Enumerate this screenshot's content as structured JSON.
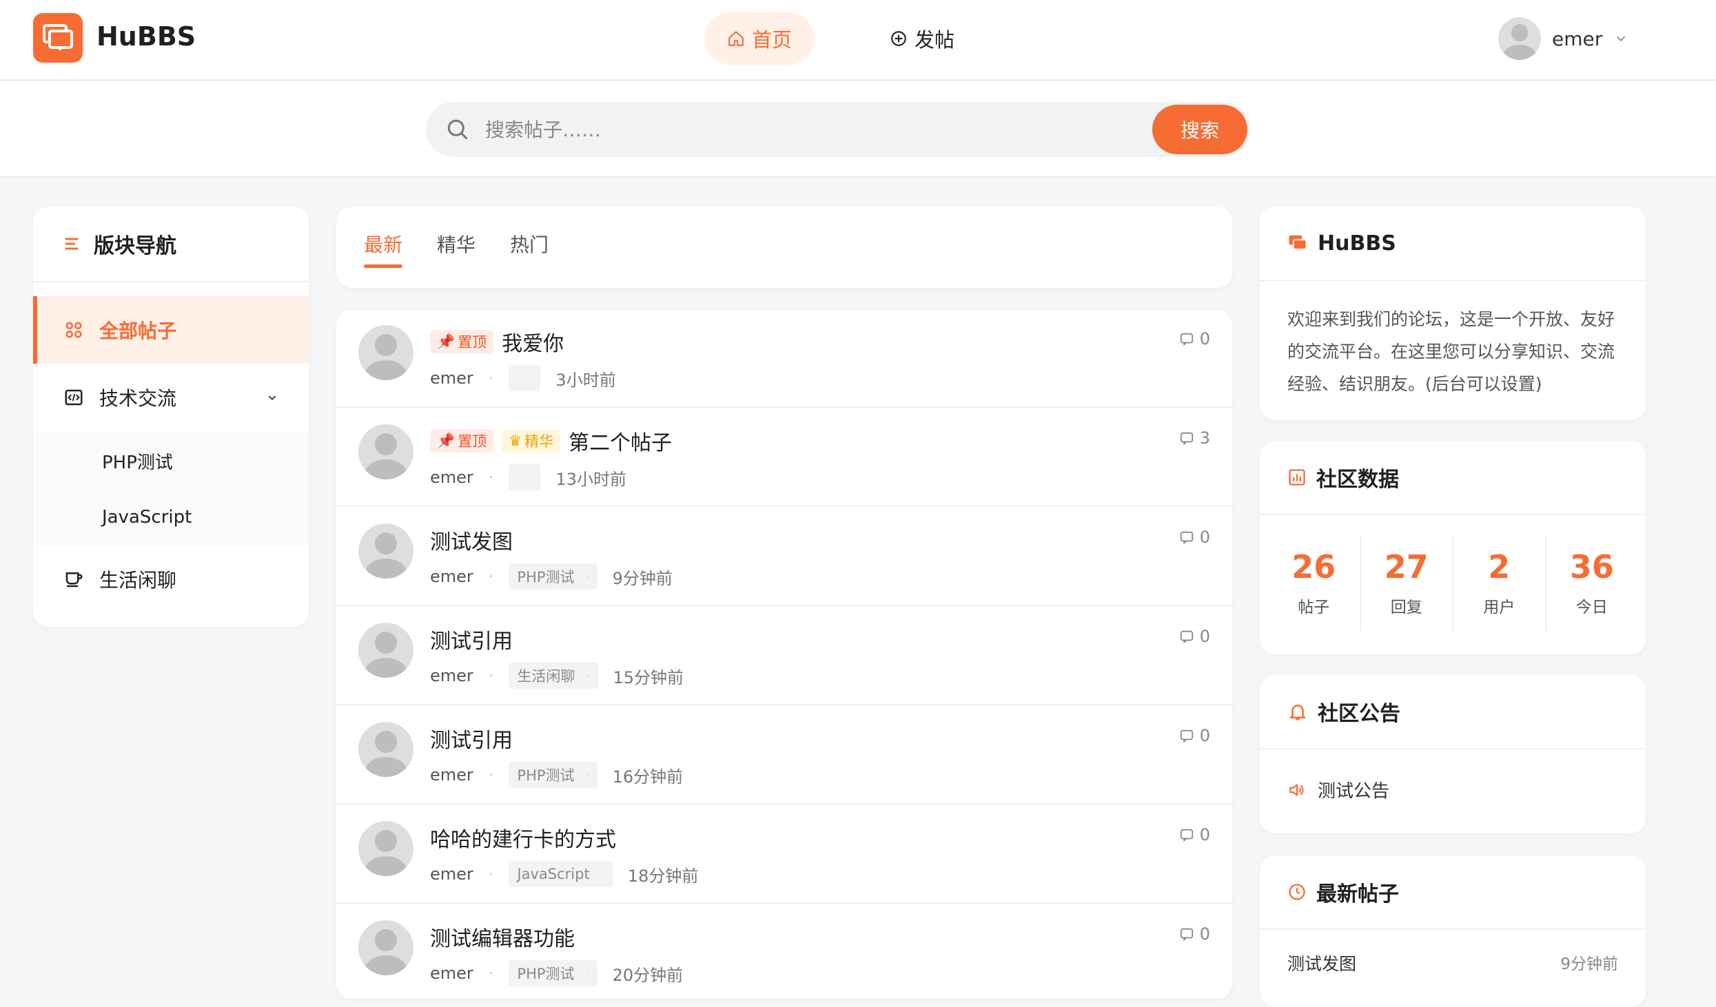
{
  "header": {
    "brand": "HuBBS",
    "nav": {
      "home": "首页",
      "post": "发帖"
    },
    "user": {
      "name": "emer"
    }
  },
  "search": {
    "placeholder": "搜索帖子……",
    "button": "搜索"
  },
  "sidebar": {
    "title": "版块导航",
    "items": [
      {
        "label": "全部帖子"
      },
      {
        "label": "技术交流"
      },
      {
        "label": "生活闲聊"
      }
    ],
    "subitems": [
      {
        "label": "PHP测试"
      },
      {
        "label": "JavaScript"
      }
    ]
  },
  "tabs": [
    {
      "label": "最新"
    },
    {
      "label": "精华"
    },
    {
      "label": "热门"
    }
  ],
  "badges": {
    "top": "置顶",
    "essence": "精华"
  },
  "posts": [
    {
      "title": "我爱你",
      "author": "emer",
      "category": "",
      "time": "3小时前",
      "comments": "0"
    },
    {
      "title": "第二个帖子",
      "author": "emer",
      "category": "",
      "time": "13小时前",
      "comments": "3"
    },
    {
      "title": "测试发图",
      "author": "emer",
      "category": "PHP测试",
      "time": "9分钟前",
      "comments": "0"
    },
    {
      "title": "测试引用",
      "author": "emer",
      "category": "生活闲聊",
      "time": "15分钟前",
      "comments": "0"
    },
    {
      "title": "测试引用",
      "author": "emer",
      "category": "PHP测试",
      "time": "16分钟前",
      "comments": "0"
    },
    {
      "title": "哈哈的建行卡的方式",
      "author": "emer",
      "category": "JavaScript",
      "time": "18分钟前",
      "comments": "0"
    },
    {
      "title": "测试编辑器功能",
      "author": "emer",
      "category": "PHP测试",
      "time": "20分钟前",
      "comments": "0"
    }
  ],
  "about": {
    "title": "HuBBS",
    "text": "欢迎来到我们的论坛，这是一个开放、友好的交流平台。在这里您可以分享知识、交流经验、结识朋友。(后台可以设置)"
  },
  "stats": {
    "title": "社区数据",
    "items": [
      {
        "value": "26",
        "label": "帖子"
      },
      {
        "value": "27",
        "label": "回复"
      },
      {
        "value": "2",
        "label": "用户"
      },
      {
        "value": "36",
        "label": "今日"
      }
    ]
  },
  "notice": {
    "title": "社区公告",
    "item": "测试公告"
  },
  "latest": {
    "title": "最新帖子",
    "item": "测试发图",
    "time": "9分钟前"
  },
  "colors": {
    "accent": "#f66c33",
    "essence": "#e9a400"
  }
}
